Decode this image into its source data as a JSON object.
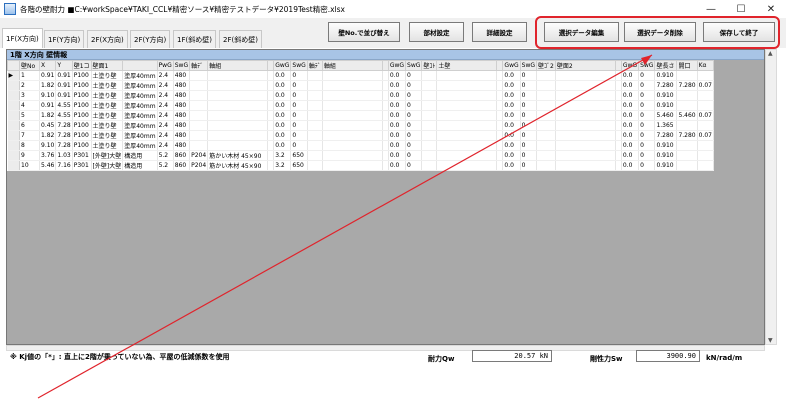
{
  "window": {
    "title": "各階の壁耐力 ■C:¥workSpace¥TAKI_CCL¥精密ソース¥精密テストデータ¥2019Test精密.xlsx",
    "minimize": "—",
    "maximize": "☐",
    "close": "✕"
  },
  "tabs": [
    "1F(X方向)",
    "1F(Y方向)",
    "2F(X方向)",
    "2F(Y方向)",
    "1F(斜め壁)",
    "2F(斜め壁)"
  ],
  "buttons": {
    "sort": "壁No.で並び替え",
    "material": "部材設定",
    "detail": "詳細設定",
    "edit": "選択データ編集",
    "delete": "選択データ削除",
    "save_exit": "保存して終了"
  },
  "grid": {
    "caption": "1階 X方向 壁情報",
    "headers": [
      "壁No",
      "X",
      "Y",
      "壁1コ",
      "壁面1",
      "",
      "PwG",
      "SwG",
      "軸ﾃﾞ",
      "軸組",
      "",
      "GwG",
      "SwG",
      "軸ﾃﾞ",
      "軸組",
      "",
      "GwG",
      "SwG",
      "壁ｺﾄ",
      "土壁",
      "",
      "GwG",
      "SwG",
      "壁ｺﾞ2",
      "壁面2",
      "",
      "GwG",
      "SwG",
      "壁長さ",
      "開口",
      "Kα"
    ],
    "rows": [
      [
        "1",
        "0.91",
        "0.91",
        "P100",
        "土塗り壁",
        "塗厚40mm",
        "2.4",
        "480",
        "",
        "",
        "",
        "0.0",
        "0",
        "",
        "",
        "",
        "0.0",
        "0",
        "",
        "",
        "",
        "0.0",
        "0",
        "",
        "",
        "",
        "0.0",
        "0",
        "0.910",
        "",
        ""
      ],
      [
        "2",
        "1.82",
        "0.91",
        "P100",
        "土塗り壁",
        "塗厚40mm",
        "2.4",
        "480",
        "",
        "",
        "",
        "0.0",
        "0",
        "",
        "",
        "",
        "0.0",
        "0",
        "",
        "",
        "",
        "0.0",
        "0",
        "",
        "",
        "",
        "0.0",
        "0",
        "7.280",
        "7.280",
        "0.07"
      ],
      [
        "3",
        "9.10",
        "0.91",
        "P100",
        "土塗り壁",
        "塗厚40mm",
        "2.4",
        "480",
        "",
        "",
        "",
        "0.0",
        "0",
        "",
        "",
        "",
        "0.0",
        "0",
        "",
        "",
        "",
        "0.0",
        "0",
        "",
        "",
        "",
        "0.0",
        "0",
        "0.910",
        "",
        ""
      ],
      [
        "4",
        "0.91",
        "4.55",
        "P100",
        "土塗り壁",
        "塗厚40mm",
        "2.4",
        "480",
        "",
        "",
        "",
        "0.0",
        "0",
        "",
        "",
        "",
        "0.0",
        "0",
        "",
        "",
        "",
        "0.0",
        "0",
        "",
        "",
        "",
        "0.0",
        "0",
        "0.910",
        "",
        ""
      ],
      [
        "5",
        "1.82",
        "4.55",
        "P100",
        "土塗り壁",
        "塗厚40mm",
        "2.4",
        "480",
        "",
        "",
        "",
        "0.0",
        "0",
        "",
        "",
        "",
        "0.0",
        "0",
        "",
        "",
        "",
        "0.0",
        "0",
        "",
        "",
        "",
        "0.0",
        "0",
        "5.460",
        "5.460",
        "0.07"
      ],
      [
        "6",
        "0.45",
        "7.28",
        "P100",
        "土塗り壁",
        "塗厚40mm",
        "2.4",
        "480",
        "",
        "",
        "",
        "0.0",
        "0",
        "",
        "",
        "",
        "0.0",
        "0",
        "",
        "",
        "",
        "0.0",
        "0",
        "",
        "",
        "",
        "0.0",
        "0",
        "1.365",
        "",
        ""
      ],
      [
        "7",
        "1.82",
        "7.28",
        "P100",
        "土塗り壁",
        "塗厚40mm",
        "2.4",
        "480",
        "",
        "",
        "",
        "0.0",
        "0",
        "",
        "",
        "",
        "0.0",
        "0",
        "",
        "",
        "",
        "0.0",
        "0",
        "",
        "",
        "",
        "0.0",
        "0",
        "7.280",
        "7.280",
        "0.07"
      ],
      [
        "8",
        "9.10",
        "7.28",
        "P100",
        "土塗り壁",
        "塗厚40mm",
        "2.4",
        "480",
        "",
        "",
        "",
        "0.0",
        "0",
        "",
        "",
        "",
        "0.0",
        "0",
        "",
        "",
        "",
        "0.0",
        "0",
        "",
        "",
        "",
        "0.0",
        "0",
        "0.910",
        "",
        ""
      ],
      [
        "9",
        "3.76",
        "1.03",
        "P301",
        "[外壁]大壁",
        "構造用",
        "5.2",
        "860",
        "P204",
        "筋かい木材 45×90",
        "",
        "3.2",
        "650",
        "",
        "",
        "",
        "0.0",
        "0",
        "",
        "",
        "",
        "0.0",
        "0",
        "",
        "",
        "",
        "0.0",
        "0",
        "0.910",
        "",
        ""
      ],
      [
        "10",
        "5.46",
        "7.16",
        "P301",
        "[外壁]大壁",
        "構造用",
        "5.2",
        "860",
        "P204",
        "筋かい木材 45×90",
        "",
        "3.2",
        "650",
        "",
        "",
        "",
        "0.0",
        "0",
        "",
        "",
        "",
        "0.0",
        "0",
        "",
        "",
        "",
        "0.0",
        "0",
        "0.910",
        "",
        ""
      ]
    ]
  },
  "footer": {
    "note": "※ Kj値の「*」: 直上に2階が乗っていない為、平屋の低減係数を使用",
    "strength_label": "耐力Qw",
    "strength_value": "20.57 kN",
    "stiffness_label": "剛性力Sw",
    "stiffness_value": "3900.90",
    "stiffness_unit": "kN/rad/m"
  },
  "colors": {
    "highlight": "#e0242c",
    "caption_bg": "#a8c4e6",
    "grid_empty_bg": "#a9a9a9"
  }
}
